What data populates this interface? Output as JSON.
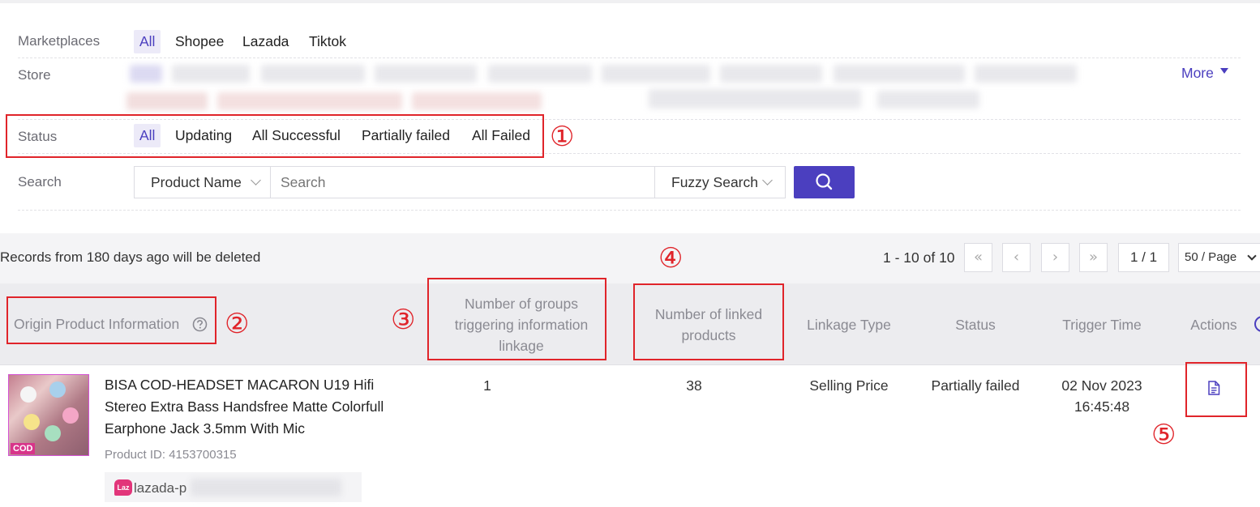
{
  "filters": {
    "marketplaces": {
      "label": "Marketplaces",
      "options": [
        "All",
        "Shopee",
        "Lazada",
        "Tiktok"
      ],
      "selected": "All"
    },
    "store": {
      "label": "Store",
      "more_label": "More"
    },
    "status": {
      "label": "Status",
      "options": [
        "All",
        "Updating",
        "All Successful",
        "Partially failed",
        "All Failed"
      ],
      "selected": "All"
    },
    "search": {
      "label": "Search",
      "field_select": "Product Name",
      "placeholder": "Search",
      "mode_select": "Fuzzy Search"
    }
  },
  "notice": "Records from 180 days ago will be deleted",
  "pagination": {
    "range_text": "1 - 10 of 10",
    "page_value": "1 / 1",
    "page_size": "50 / Page"
  },
  "table": {
    "headers": {
      "origin": "Origin Product Information",
      "groups": "Number of groups triggering information linkage",
      "linked": "Number of linked products",
      "linkage_type": "Linkage Type",
      "status": "Status",
      "trigger_time": "Trigger Time",
      "actions": "Actions"
    },
    "rows": [
      {
        "thumb_badge": "COD",
        "product_name": "BISA COD-HEADSET MACARON U19 Hifi Stereo Extra Bass Handsfree Matte Colorfull Earphone Jack 3.5mm With Mic",
        "product_id": "Product ID: 4153700315",
        "store_badge": "Laz",
        "store": "lazada-p",
        "groups": "1",
        "linked": "38",
        "linkage_type": "Selling Price",
        "status": "Partially failed",
        "trigger_date": "02 Nov 2023",
        "trigger_clock": "16:45:48"
      }
    ]
  },
  "annotations": [
    "①",
    "②",
    "③",
    "④",
    "⑤"
  ],
  "colors": {
    "accent": "#4b3fbf",
    "annotation": "#e0242a"
  },
  "icons": [
    "help-circle-icon",
    "search-icon",
    "document-icon",
    "first-page-icon",
    "prev-page-icon",
    "next-page-icon",
    "last-page-icon"
  ]
}
